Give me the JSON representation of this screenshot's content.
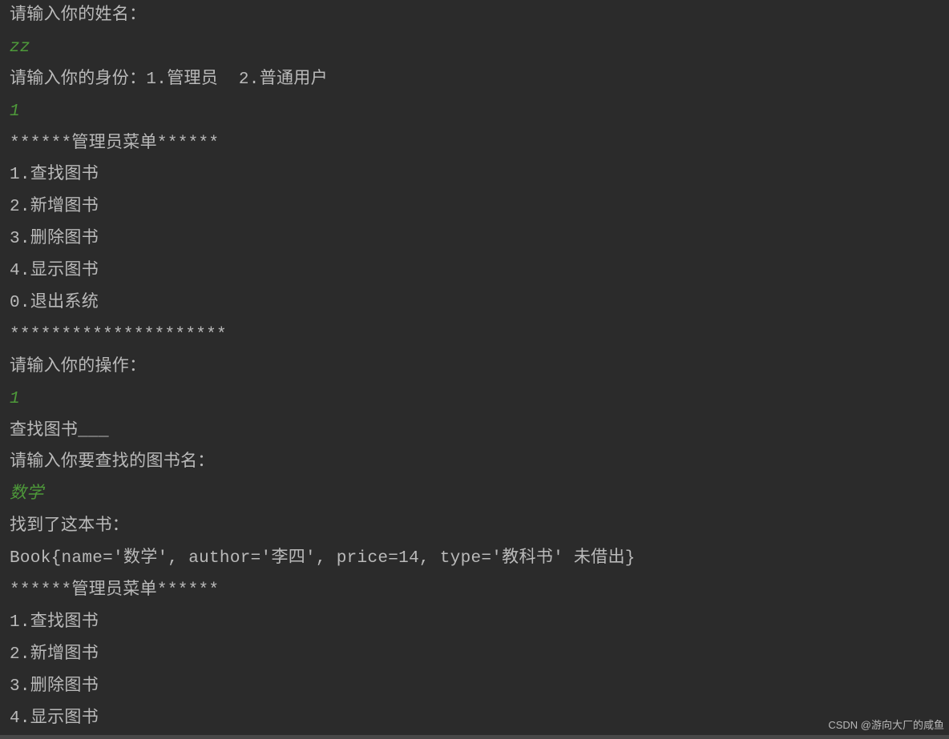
{
  "lines": [
    {
      "text": "请输入你的姓名：",
      "type": "output"
    },
    {
      "text": "zz",
      "type": "input"
    },
    {
      "text": "请输入你的身份：1.管理员  2.普通用户",
      "type": "output"
    },
    {
      "text": "1",
      "type": "input"
    },
    {
      "text": "",
      "type": "output"
    },
    {
      "text": "******管理员菜单******",
      "type": "output"
    },
    {
      "text": "1.查找图书",
      "type": "output"
    },
    {
      "text": "2.新增图书",
      "type": "output"
    },
    {
      "text": "3.删除图书",
      "type": "output"
    },
    {
      "text": "4.显示图书",
      "type": "output"
    },
    {
      "text": "0.退出系统",
      "type": "output"
    },
    {
      "text": "*********************",
      "type": "output"
    },
    {
      "text": "请输入你的操作：",
      "type": "output"
    },
    {
      "text": "1",
      "type": "input"
    },
    {
      "text": "查找图书___",
      "type": "output"
    },
    {
      "text": "请输入你要查找的图书名：",
      "type": "output"
    },
    {
      "text": "数学",
      "type": "input"
    },
    {
      "text": "找到了这本书：",
      "type": "output"
    },
    {
      "text": "Book{name='数学', author='李四', price=14, type='教科书' 未借出}",
      "type": "output"
    },
    {
      "text": "******管理员菜单******",
      "type": "output"
    },
    {
      "text": "1.查找图书",
      "type": "output"
    },
    {
      "text": "2.新增图书",
      "type": "output"
    },
    {
      "text": "3.删除图书",
      "type": "output"
    },
    {
      "text": "4.显示图书",
      "type": "output"
    }
  ],
  "watermark": "CSDN @游向大厂的咸鱼"
}
